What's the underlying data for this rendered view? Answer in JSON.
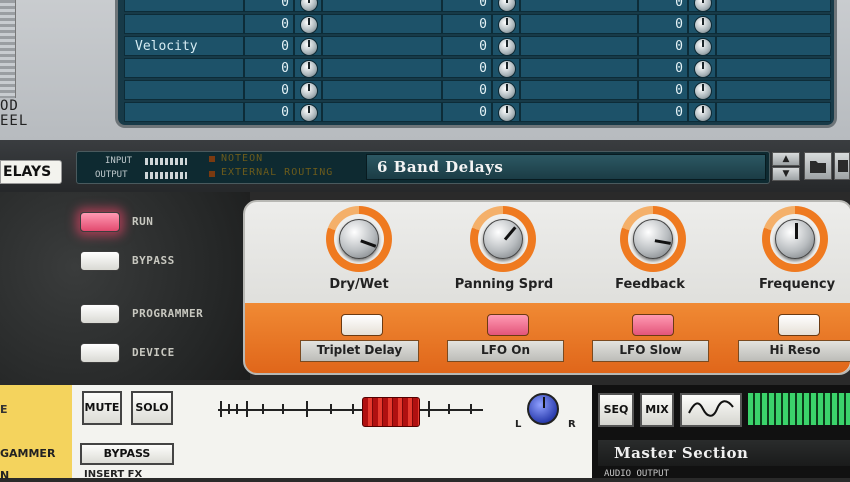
{
  "programmer_table": {
    "wheel_label_top": "OD",
    "wheel_label_bottom": "EEL",
    "rows": [
      {
        "label": "",
        "v1": "0",
        "v2": "0",
        "v3": "0"
      },
      {
        "label": "Velocity",
        "v1": "0",
        "v2": "0",
        "v3": "0"
      },
      {
        "label": "",
        "v1": "0",
        "v2": "0",
        "v3": "0"
      },
      {
        "label": "",
        "v1": "0",
        "v2": "0",
        "v3": "0"
      },
      {
        "label": "",
        "v1": "0",
        "v2": "0",
        "v3": "0"
      }
    ],
    "top_row_values": [
      "0",
      "0",
      "0"
    ]
  },
  "device_header": {
    "device_tab": "ELAYS",
    "input_label": "INPUT",
    "output_label": "OUTPUT",
    "noteon_label": "NOTEON",
    "routing_label": "EXTERNAL ROUTING",
    "patch_name": "6 Band Delays"
  },
  "side_panel": {
    "run_label": "RUN",
    "bypass_label": "BYPASS",
    "programmer_label": "PROGRAMMER",
    "device_label": "DEVICE"
  },
  "front_panel": {
    "knobs": [
      "Dry/Wet",
      "Panning Sprd",
      "Feedback",
      "Frequency"
    ],
    "toggles": [
      "Triplet Delay",
      "LFO On",
      "LFO Slow",
      "Hi Reso"
    ],
    "toggle_states": [
      false,
      true,
      true,
      false
    ]
  },
  "mixer": {
    "left_labels": [
      "E",
      "GAMMER",
      "N"
    ],
    "mute_label": "MUTE",
    "solo_label": "SOLO",
    "bypass_label": "BYPASS",
    "insert_label": "INSERT FX",
    "pan_left": "L",
    "pan_right": "R"
  },
  "master": {
    "seq_label": "SEQ",
    "mix_label": "MIX",
    "title": "Master Section",
    "subtitle": "AUDIO OUTPUT"
  },
  "colors": {
    "accent_orange": "#ef7a20",
    "table_bg": "#173a48",
    "led_pink": "#ff6b8f"
  }
}
